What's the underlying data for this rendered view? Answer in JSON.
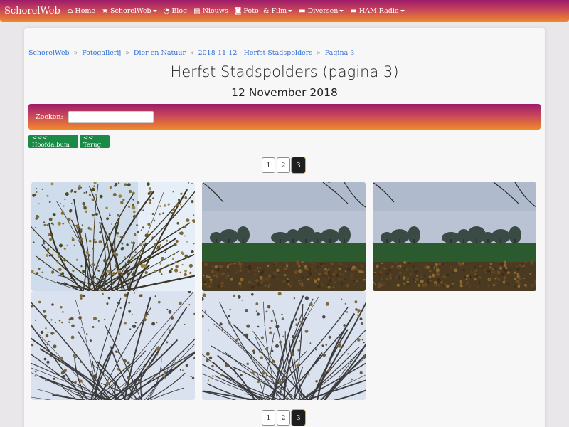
{
  "navbar": {
    "brand": "SchorelWeb",
    "items": [
      {
        "label": "Home",
        "icon": "home-icon",
        "glyph": "⌂",
        "dropdown": false
      },
      {
        "label": "SchorelWeb",
        "icon": "star-icon",
        "glyph": "★",
        "dropdown": true
      },
      {
        "label": "Blog",
        "icon": "rss-icon",
        "glyph": "◔",
        "dropdown": false
      },
      {
        "label": "Nieuws",
        "icon": "newspaper-icon",
        "glyph": "▤",
        "dropdown": false
      },
      {
        "label": "Foto- & Film",
        "icon": "camera-icon",
        "glyph": "◙",
        "dropdown": true
      },
      {
        "label": "Diversen",
        "icon": "folder-icon",
        "glyph": "▬",
        "dropdown": true
      },
      {
        "label": "HAM Radio",
        "icon": "folder-icon",
        "glyph": "▬",
        "dropdown": true
      }
    ]
  },
  "breadcrumb": [
    "SchorelWeb",
    "Fotogallerij",
    "Dier en Natuur",
    "2018-11-12 - Herfst Stadspolders",
    "Pagina 3"
  ],
  "breadcrumb_separator": "»",
  "page": {
    "title": "Herfst Stadspolders (pagina 3)",
    "subtitle": "12 November 2018"
  },
  "search": {
    "label": "Zoeken:",
    "value": "",
    "placeholder": ""
  },
  "buttons": {
    "main_album": "<<< Hoofdalbum",
    "back": "<< Terug"
  },
  "pagination": {
    "pages": [
      "1",
      "2",
      "3"
    ],
    "current": "3"
  },
  "photos": [
    {
      "kind": "tree-closeup"
    },
    {
      "kind": "field-landscape"
    },
    {
      "kind": "field-landscape"
    },
    {
      "kind": "bare-trees"
    },
    {
      "kind": "bare-trees"
    }
  ],
  "colors": {
    "navbar_start": "#9c1a6a",
    "navbar_end": "#f08a2a",
    "link": "#2f6fd6",
    "button_green": "#1a8a46"
  }
}
